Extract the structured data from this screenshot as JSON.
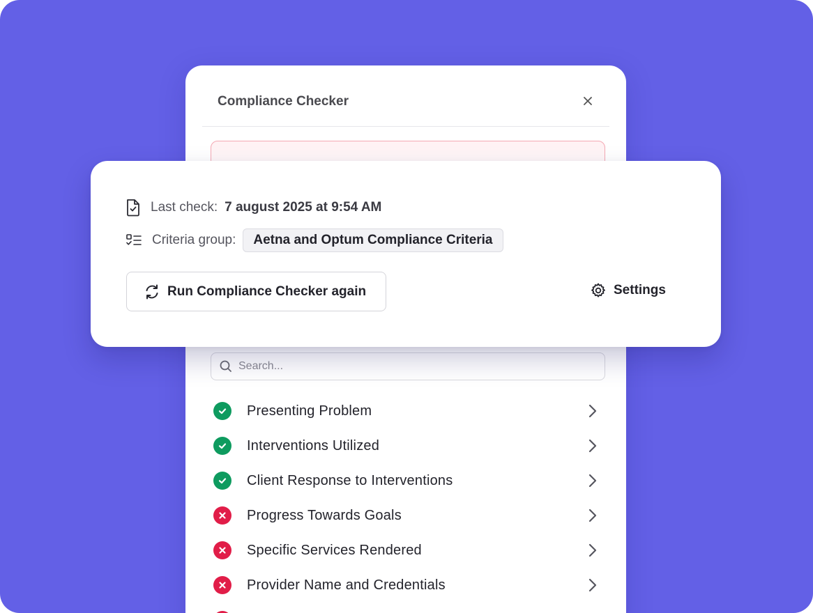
{
  "panel": {
    "title": "Compliance Checker",
    "close_icon": "close-icon",
    "search_placeholder": "Search...",
    "criteria": [
      {
        "label": "Presenting Problem",
        "status": "pass"
      },
      {
        "label": "Interventions Utilized",
        "status": "pass"
      },
      {
        "label": "Client Response to Interventions",
        "status": "pass"
      },
      {
        "label": "Progress Towards Goals",
        "status": "fail"
      },
      {
        "label": "Specific Services Rendered",
        "status": "fail"
      },
      {
        "label": "Provider Name and Credentials",
        "status": "fail"
      }
    ]
  },
  "card": {
    "last_check_label": "Last check:",
    "last_check_value": "7 august 2025 at 9:54 AM",
    "criteria_group_label": "Criteria group:",
    "criteria_group_value": "Aetna and Optum Compliance Criteria",
    "run_again_label": "Run Compliance Checker again",
    "settings_label": "Settings"
  },
  "colors": {
    "background": "#6360e6",
    "pass": "#0e9b5f",
    "fail": "#e11d48",
    "alert_border": "#f4a8b3"
  }
}
